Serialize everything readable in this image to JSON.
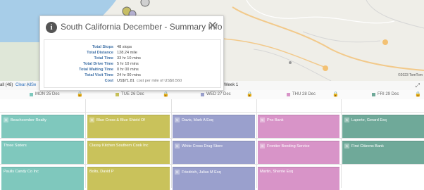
{
  "map": {
    "attribution": "©2023 TomTom"
  },
  "toolbar": {
    "all_label": "all (48)",
    "clear_all": "Clear All",
    "sep": "Se",
    "week_label": "Week 1"
  },
  "days": [
    {
      "label": "MON 25 Dec",
      "color": "#7fc8bd"
    },
    {
      "label": "TUE 26 Dec",
      "color": "#c9c25b"
    },
    {
      "label": "WED 27 Dec",
      "color": "#9aa0cd"
    },
    {
      "label": "THU 28 Dec",
      "color": "#d894c8"
    },
    {
      "label": "FRI 29 Dec",
      "color": "#6fa999"
    }
  ],
  "stops": [
    {
      "col": 0,
      "row": 0,
      "num": "8",
      "label": "Beachcomber Realty"
    },
    {
      "col": 0,
      "row": 1,
      "num": "",
      "label": "Three Sisters"
    },
    {
      "col": 0,
      "row": 2,
      "num": "",
      "label": "Paulls Candy Co Inc"
    },
    {
      "col": 1,
      "row": 0,
      "num": "8",
      "label": "Blue Cross & Blue Shield Of"
    },
    {
      "col": 1,
      "row": 1,
      "num": "",
      "label": "Classy Kitchen Southern Cook Inc"
    },
    {
      "col": 1,
      "row": 2,
      "num": "",
      "label": "Bolts, David P"
    },
    {
      "col": 2,
      "row": 0,
      "num": "5",
      "label": "Davis, Mark A Esq"
    },
    {
      "col": 2,
      "row": 1,
      "num": "6",
      "label": "White Cross Drug Store"
    },
    {
      "col": 2,
      "row": 2,
      "num": "8",
      "label": "Friedrich, Julius M Esq"
    },
    {
      "col": 3,
      "row": 0,
      "num": "5",
      "label": "Pnc Bank"
    },
    {
      "col": 3,
      "row": 1,
      "num": "6",
      "label": "Frontier Bonding Service"
    },
    {
      "col": 3,
      "row": 2,
      "num": "",
      "label": "Martin, Sherrie Esq"
    },
    {
      "col": 4,
      "row": 0,
      "num": "5",
      "label": "Laporte, Gerard Esq"
    },
    {
      "col": 4,
      "row": 1,
      "num": "6",
      "label": "First Citizens Bank"
    }
  ],
  "popup": {
    "title": "South California December - Summary Info",
    "rows": [
      {
        "key": "Total Stops",
        "value": "48 stops",
        "note": ""
      },
      {
        "key": "Total Distance",
        "value": "128.24 mile",
        "note": ""
      },
      {
        "key": "Total Time",
        "value": "33 hr 10 mins",
        "note": ""
      },
      {
        "key": "Total Drive Time",
        "value": "5 hr 10 mins",
        "note": ""
      },
      {
        "key": "Total Waiting Time",
        "value": "0 hr 00 mins",
        "note": ""
      },
      {
        "key": "Total Visit Time",
        "value": "24 hr 00 mins",
        "note": ""
      },
      {
        "key": "Cost",
        "value": "US$71.81",
        "note": "cost per mile of US$0.560"
      }
    ]
  },
  "icons": {
    "info": "info-icon",
    "close": "close-icon",
    "lock": "lock-icon",
    "expand": "expand-icon"
  }
}
